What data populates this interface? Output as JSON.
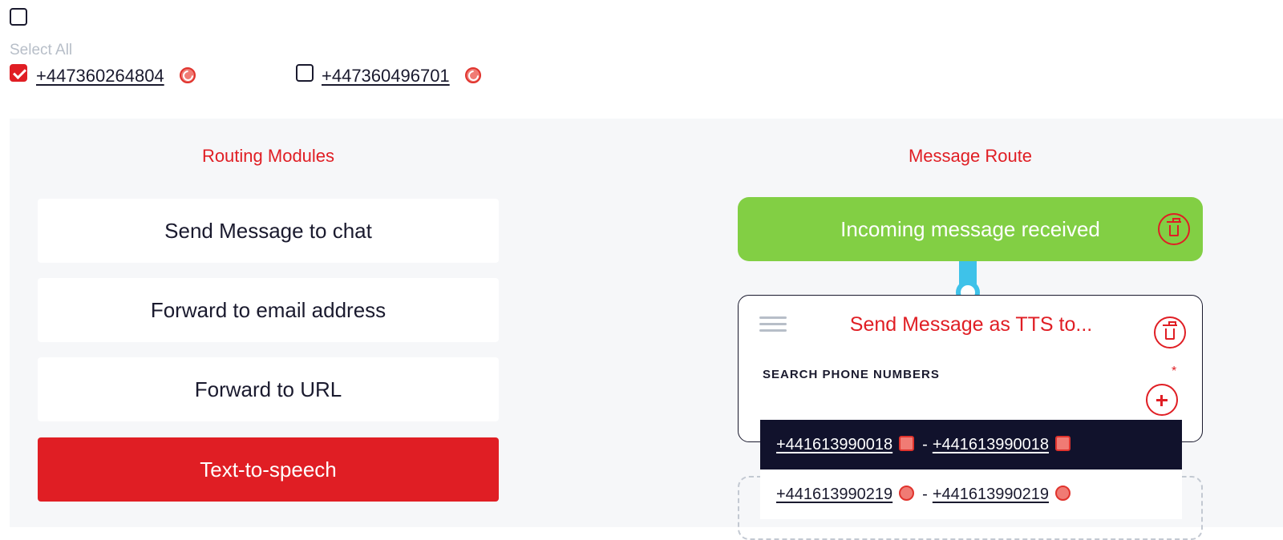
{
  "top": {
    "select_all_label": "Select All",
    "numbers": [
      {
        "number": "+447360264804",
        "checked": true
      },
      {
        "number": "+447360496701",
        "checked": false
      }
    ]
  },
  "routing": {
    "title": "Routing Modules",
    "modules": [
      {
        "label": "Send Message to chat",
        "active": false
      },
      {
        "label": "Forward to email address",
        "active": false
      },
      {
        "label": "Forward to URL",
        "active": false
      },
      {
        "label": "Text-to-speech",
        "active": true
      }
    ]
  },
  "route": {
    "title": "Message Route",
    "incoming_label": "Incoming message received",
    "tts_card": {
      "title": "Send Message as TTS to...",
      "search_label": "SEARCH PHONE NUMBERS",
      "required_mark": "*"
    },
    "dropdown": [
      {
        "from": "+441613990018",
        "sep": "-",
        "to": "+441613990018",
        "highlighted": true
      },
      {
        "from": "+441613990219",
        "sep": "-",
        "to": "+441613990219",
        "highlighted": false
      }
    ]
  },
  "colors": {
    "accent": "#e01e24",
    "incoming": "#82cf44",
    "connector": "#3ec2e9",
    "dropdown_highlight": "#11122c"
  }
}
